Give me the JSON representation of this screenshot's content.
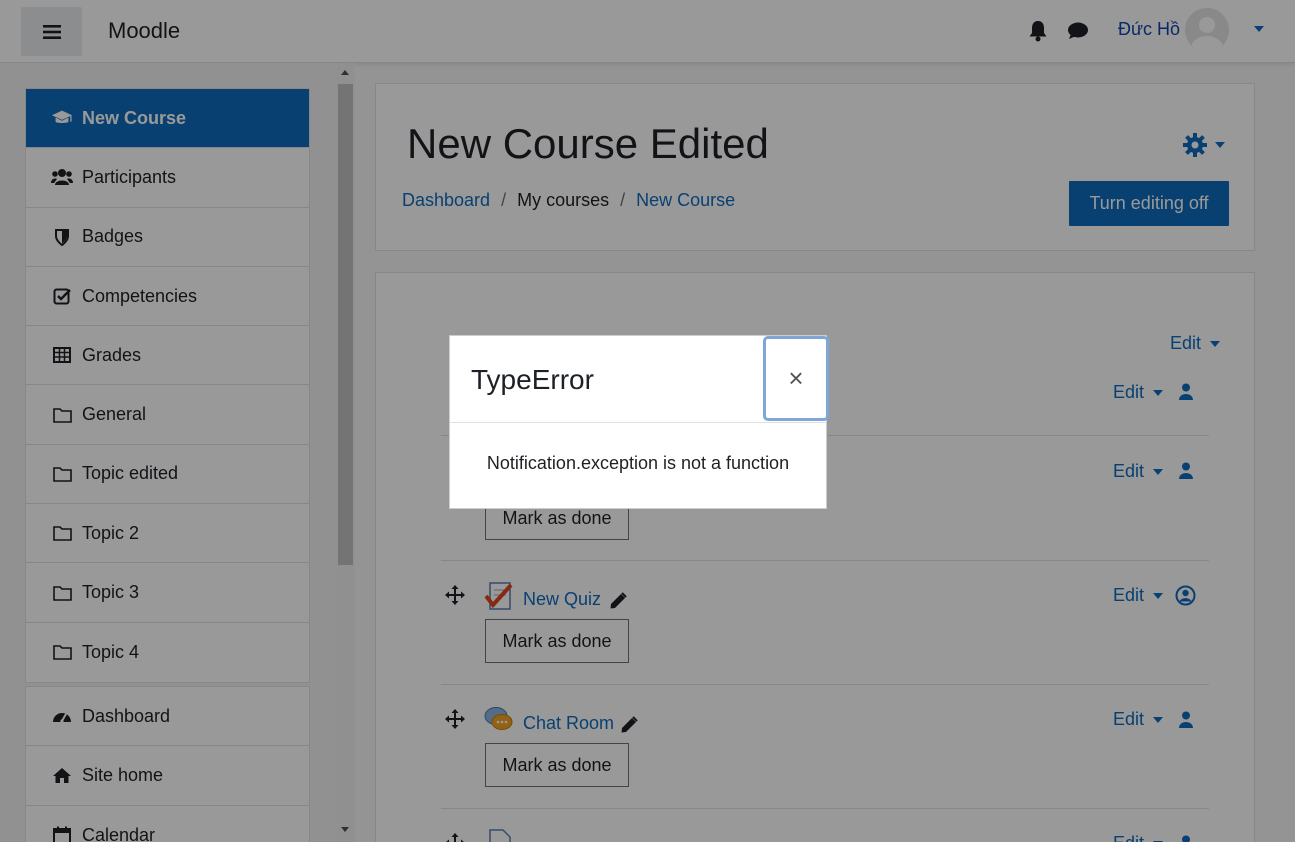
{
  "navbar": {
    "brand": "Moodle",
    "user_name": "Đức Hồ"
  },
  "drawer": {
    "course_items": [
      {
        "label": "New Course",
        "icon": "graduation-cap-icon"
      },
      {
        "label": "Participants",
        "icon": "users-icon"
      },
      {
        "label": "Badges",
        "icon": "shield-icon"
      },
      {
        "label": "Competencies",
        "icon": "check-square-icon"
      },
      {
        "label": "Grades",
        "icon": "table-icon"
      },
      {
        "label": "General",
        "icon": "folder-icon"
      },
      {
        "label": "Topic edited",
        "icon": "folder-icon"
      },
      {
        "label": "Topic 2",
        "icon": "folder-icon"
      },
      {
        "label": "Topic 3",
        "icon": "folder-icon"
      },
      {
        "label": "Topic 4",
        "icon": "folder-icon"
      }
    ],
    "site_items": [
      {
        "label": "Dashboard",
        "icon": "tachometer-icon"
      },
      {
        "label": "Site home",
        "icon": "home-icon"
      },
      {
        "label": "Calendar",
        "icon": "calendar-icon"
      }
    ]
  },
  "header": {
    "title": "New Course Edited",
    "breadcrumb": [
      "Dashboard",
      "My courses",
      "New Course"
    ],
    "editing_button": "Turn editing off"
  },
  "content": {
    "section_edit": "Edit",
    "edit_label": "Edit",
    "mark_done": "Mark as done",
    "activities": [
      {
        "name": "New Quiz",
        "icon": "quiz-icon"
      },
      {
        "name": "Chat Room",
        "icon": "chat-icon"
      }
    ]
  },
  "modal": {
    "title": "TypeError",
    "message": "Notification.exception is not a function",
    "close_symbol": "×"
  },
  "colors": {
    "primary": "#0f6cbf",
    "backdrop": "rgba(0,0,0,0.4)"
  }
}
